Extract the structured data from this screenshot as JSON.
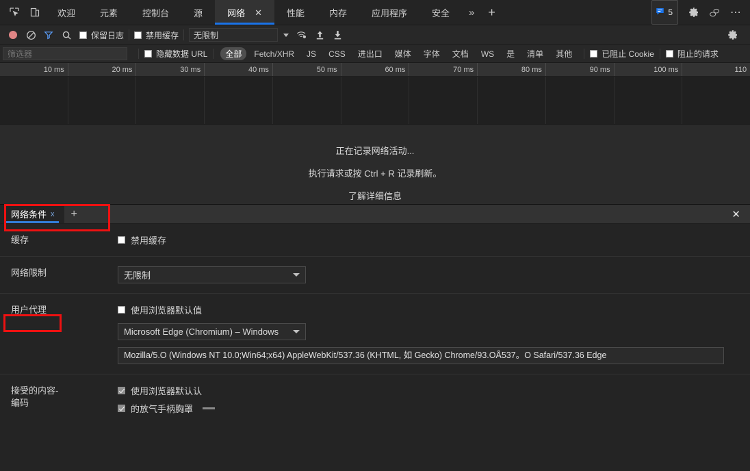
{
  "window": {
    "bg": "#242424",
    "accent": "#1a73e8"
  },
  "main_tabbar": {
    "inspect_icon": "inspect-element-icon",
    "device_icon": "device-toolbar-icon",
    "tabs": [
      {
        "label": "欢迎",
        "selected": false
      },
      {
        "label": "元素",
        "selected": false
      },
      {
        "label": "控制台",
        "selected": false
      },
      {
        "label": "源",
        "selected": false
      },
      {
        "label": "网络",
        "selected": true,
        "close": "✕"
      },
      {
        "label": "性能",
        "selected": false
      },
      {
        "label": "内存",
        "selected": false
      },
      {
        "label": "应用程序",
        "selected": false
      },
      {
        "label": "安全",
        "selected": false
      }
    ],
    "more_tabs": "»",
    "add_tab": "+",
    "message_count": "5",
    "message_icon": "message-icon",
    "settings_icon": "gear-icon",
    "feedback_icon": "feedback-icon",
    "more_options": "⋯"
  },
  "network_toolbar": {
    "record_icon": "record-button",
    "clear_icon": "clear-icon",
    "filter_icon": "filter-icon",
    "search_icon": "search-icon",
    "preserve_log_label": "保留日志",
    "preserve_log_checked": false,
    "disable_cache_label": "禁用缓存",
    "disable_cache_checked": false,
    "throttling_value": "无限制",
    "wifi_icon": "network-conditions-icon",
    "import_icon": "import-har-icon",
    "export_icon": "export-har-icon",
    "settings_icon": "gear-icon"
  },
  "filter_bar": {
    "filter_placeholder": "筛选器",
    "filter_value": "",
    "hide_data_urls_label": "隐藏数据 URL",
    "hide_data_urls_checked": false,
    "type_chips": [
      {
        "label": "全部",
        "active": true
      },
      {
        "label": "Fetch/XHR",
        "active": false
      },
      {
        "label": "JS",
        "active": false
      },
      {
        "label": "CSS",
        "active": false
      },
      {
        "label": "进出口",
        "active": false
      },
      {
        "label": "媒体",
        "active": false
      },
      {
        "label": "字体",
        "active": false
      },
      {
        "label": "文档",
        "active": false
      },
      {
        "label": "WS",
        "active": false
      },
      {
        "label": "是",
        "active": false
      },
      {
        "label": "清单",
        "active": false
      },
      {
        "label": "其他",
        "active": false
      }
    ],
    "blocked_cookies_label": "已阻止 Cookie",
    "blocked_cookies_checked": false,
    "blocked_requests_label": "阻止的请求",
    "blocked_requests_checked": false
  },
  "timeline": {
    "ticks": [
      "10 ms",
      "20 ms",
      "30 ms",
      "40 ms",
      "50 ms",
      "60 ms",
      "70 ms",
      "80 ms",
      "90 ms",
      "100 ms",
      "110"
    ]
  },
  "network_panel": {
    "recording_text": "正在记录网络活动...",
    "instruction_text": "执行请求或按 Ctrl + R 记录刷新。",
    "learn_more_text": "了解详细信息"
  },
  "drawer": {
    "tab_label": "网络条件",
    "tab_close": "x",
    "add_tab": "+",
    "close_drawer": "✕"
  },
  "network_conditions": {
    "cache": {
      "label": "缓存",
      "disable_cache_label": "禁用缓存",
      "disable_cache_checked": false
    },
    "throttling": {
      "label": "网络限制",
      "value": "无限制"
    },
    "user_agent": {
      "label": "用户代理",
      "use_browser_default_label": "使用浏览器默认值",
      "use_browser_default_checked": false,
      "preset_value": "Microsoft Edge (Chromium) – Windows",
      "ua_string": "Mozilla/5.O (Windows NT 10.0;Win64;x64) AppleWebKit/537.36 (KHTML, 如 Gecko) Chrome/93.OÅ537。O Safari/537.36 Edge"
    },
    "accept_encoding": {
      "label_line1": "接受的内容-",
      "label_line2": "编码",
      "options": [
        {
          "label": "使用浏览器默认认",
          "checked": true
        },
        {
          "label": "的放气手柄胸罩",
          "checked": true
        }
      ]
    }
  }
}
